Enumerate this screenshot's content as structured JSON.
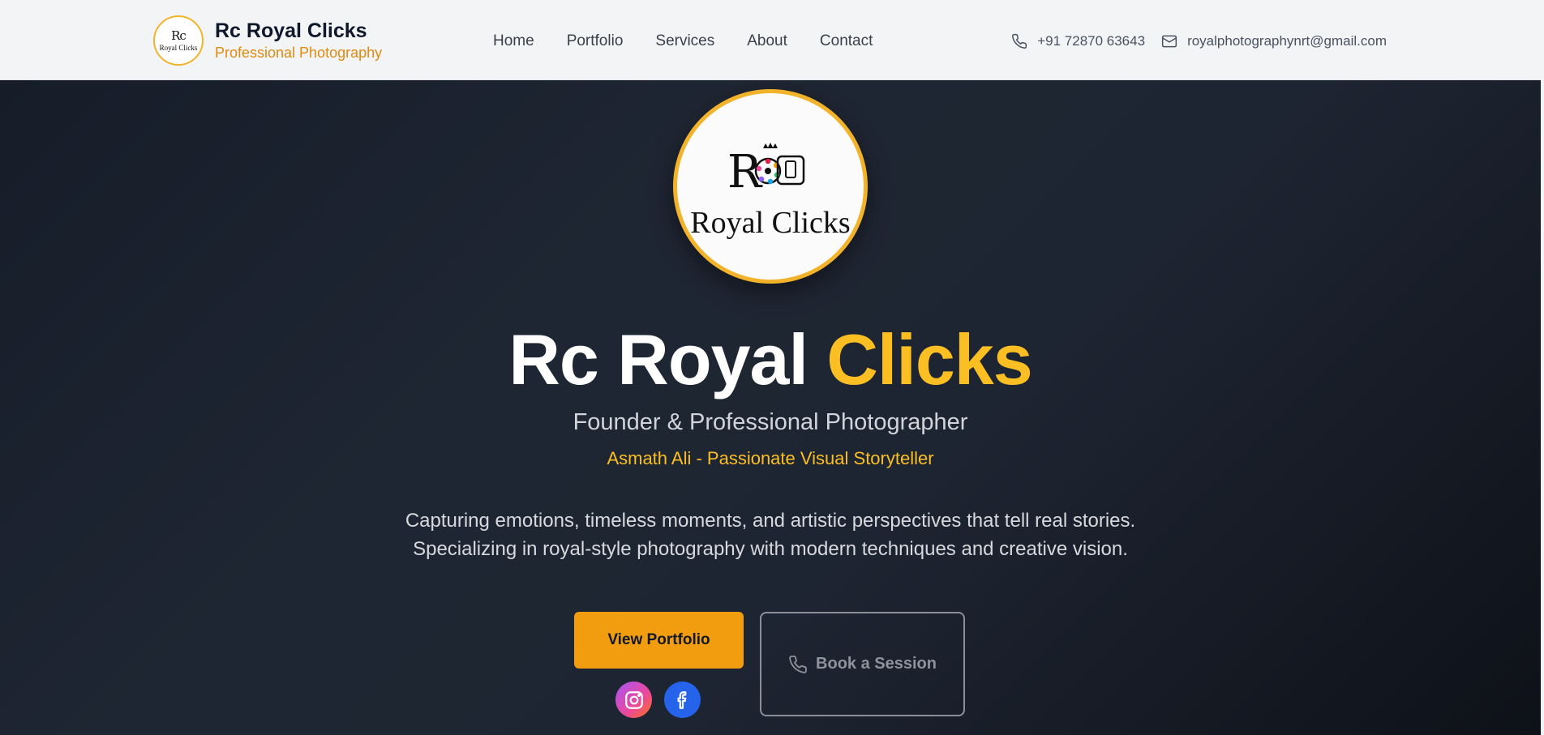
{
  "header": {
    "brand": {
      "logo_mono": "Rc",
      "logo_text": "Royal Clicks",
      "title": "Rc Royal Clicks",
      "subtitle": "Professional Photography"
    },
    "nav": [
      {
        "label": "Home"
      },
      {
        "label": "Portfolio"
      },
      {
        "label": "Services"
      },
      {
        "label": "About"
      },
      {
        "label": "Contact"
      }
    ],
    "contact": {
      "phone": "+91 72870 63643",
      "phone_icon": "phone-icon",
      "email": "royalphotographynrt@gmail.com",
      "email_icon": "mail-icon"
    }
  },
  "hero": {
    "logo_text": "Royal Clicks",
    "title_main": "Rc Royal",
    "title_accent": "Clicks",
    "role": "Founder & Professional Photographer",
    "name_line": "Asmath Ali - Passionate Visual Storyteller",
    "description_line1": "Capturing emotions, timeless moments, and artistic perspectives that tell real stories.",
    "description_line2": "Specializing in royal-style photography with modern techniques and creative vision.",
    "primary_button": "View Portfolio",
    "secondary_button": "Book a Session",
    "secondary_button_icon": "phone-icon",
    "social": [
      {
        "icon": "instagram-icon"
      },
      {
        "icon": "facebook-icon"
      }
    ]
  },
  "colors": {
    "accent": "#fbbf24",
    "button_orange": "#f29d0f",
    "header_bg": "#f3f4f6",
    "hero_bg": "#1f2633",
    "instagram": "#ec4899",
    "facebook": "#2563eb"
  }
}
